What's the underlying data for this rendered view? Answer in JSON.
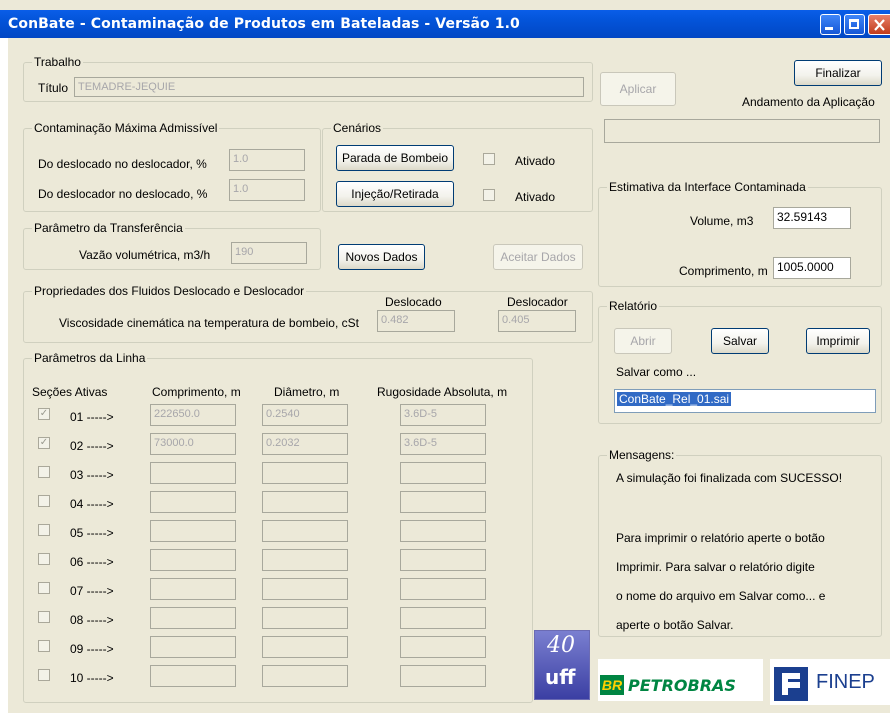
{
  "window": {
    "title": "ConBate - Contaminação de Produtos em Bateladas - Versão 1.0"
  },
  "trabalho": {
    "legend": "Trabalho",
    "titulo_label": "Título",
    "titulo_value": "TEMADRE-JEQUIE"
  },
  "contaminacao": {
    "legend": "Contaminação Máxima Admissível",
    "row1_label": "Do deslocado no deslocador, %",
    "row1_value": "1.0",
    "row2_label": "Do deslocador no deslocado, %",
    "row2_value": "1.0"
  },
  "cenarios": {
    "legend": "Cenários",
    "btn1": "Parada de Bombeio",
    "btn2": "Injeção/Retirada",
    "ativado1": "Ativado",
    "ativado2": "Ativado"
  },
  "transferencia": {
    "legend": "Parâmetro da Transferência",
    "vazao_label": "Vazão volumétrica, m3/h",
    "vazao_value": "190"
  },
  "buttons": {
    "novos_dados": "Novos Dados",
    "aceitar_dados": "Aceitar Dados",
    "aplicar": "Aplicar",
    "finalizar": "Finalizar"
  },
  "propriedades": {
    "legend": "Propriedades dos Fluidos Deslocado e Deslocador",
    "col_deslocado": "Deslocado",
    "col_deslocador": "Deslocador",
    "visc_label": "Viscosidade cinemática na temperatura de bombeio, cSt",
    "visc_deslocado": "0.482",
    "visc_deslocador": "0.405"
  },
  "linha": {
    "legend": "Parâmetros da Linha",
    "headers": [
      "Seções Ativas",
      "Comprimento, m",
      "Diâmetro, m",
      "Rugosidade Absoluta, m"
    ],
    "rows": [
      {
        "label": "01 ----->",
        "checked": true,
        "comprimento": "222650.0",
        "diametro": "0.2540",
        "rugosidade": "3.6D-5"
      },
      {
        "label": "02 ----->",
        "checked": true,
        "comprimento": "73000.0",
        "diametro": "0.2032",
        "rugosidade": "3.6D-5"
      },
      {
        "label": "03 ----->",
        "checked": false,
        "comprimento": "",
        "diametro": "",
        "rugosidade": ""
      },
      {
        "label": "04 ----->",
        "checked": false,
        "comprimento": "",
        "diametro": "",
        "rugosidade": ""
      },
      {
        "label": "05 ----->",
        "checked": false,
        "comprimento": "",
        "diametro": "",
        "rugosidade": ""
      },
      {
        "label": "06 ----->",
        "checked": false,
        "comprimento": "",
        "diametro": "",
        "rugosidade": ""
      },
      {
        "label": "07 ----->",
        "checked": false,
        "comprimento": "",
        "diametro": "",
        "rugosidade": ""
      },
      {
        "label": "08 ----->",
        "checked": false,
        "comprimento": "",
        "diametro": "",
        "rugosidade": ""
      },
      {
        "label": "09 ----->",
        "checked": false,
        "comprimento": "",
        "diametro": "",
        "rugosidade": ""
      },
      {
        "label": "10 ----->",
        "checked": false,
        "comprimento": "",
        "diametro": "",
        "rugosidade": ""
      }
    ]
  },
  "andamento": {
    "label": "Andamento da Aplicação"
  },
  "estimativa": {
    "legend": "Estimativa da Interface Contaminada",
    "volume_label": "Volume, m3",
    "volume_value": "32.59143",
    "comprimento_label": "Comprimento, m",
    "comprimento_value": "1005.0000"
  },
  "relatorio": {
    "legend": "Relatório",
    "abrir": "Abrir",
    "salvar": "Salvar",
    "imprimir": "Imprimir",
    "salvar_como_label": "Salvar como ...",
    "filename": "ConBate_Rel_01.sai"
  },
  "mensagens": {
    "legend": "Mensagens:",
    "lines": [
      "A simulação foi finalizada com SUCESSO!",
      "",
      "Para imprimir o relatório aperte o botão",
      "Imprimir. Para salvar o relatório digite",
      "o nome do arquivo em Salvar como... e",
      "aperte o botão Salvar."
    ]
  },
  "logos": {
    "uff_number": "40",
    "uff_text": "uff",
    "petrobras_br": "BR",
    "petrobras_text": "PETROBRAS",
    "finep_text": "FINEP"
  },
  "colors": {
    "titlebar": "#0353d8",
    "dialog_bg": "#ece9d8",
    "petrobras_green": "#008542",
    "petrobras_yellow": "#ffd100",
    "finep_blue": "#1b3f8f"
  }
}
